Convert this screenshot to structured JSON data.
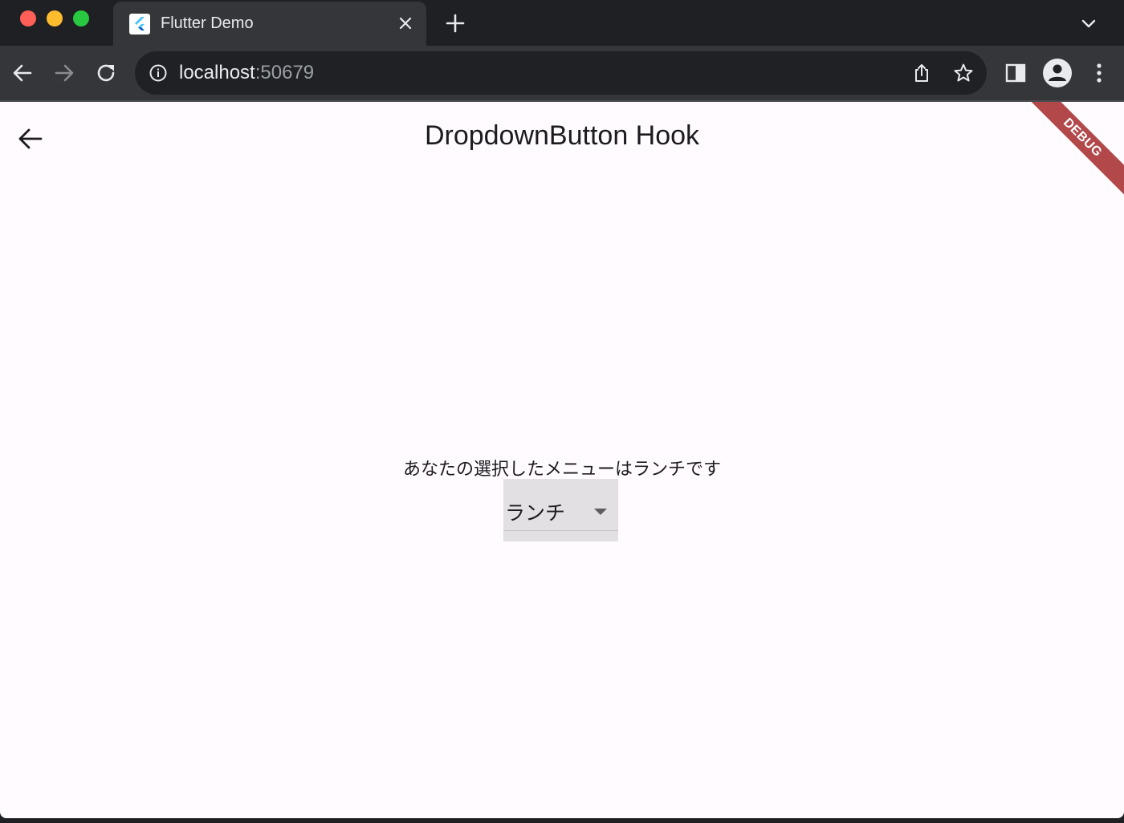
{
  "browser": {
    "tab": {
      "title": "Flutter Demo",
      "favicon": "flutter-logo-icon"
    },
    "address": {
      "host": "localhost",
      "port": ":50679"
    },
    "icons": {
      "back": "back-arrow-icon",
      "forward": "forward-arrow-icon",
      "reload": "reload-icon",
      "info": "info-icon",
      "share": "share-icon",
      "bookmark": "star-icon",
      "side_panel": "side-panel-icon",
      "profile": "profile-icon",
      "menu": "kebab-menu-icon"
    },
    "colors": {
      "chrome_dark": "#1f2023",
      "tab_active": "#35363a",
      "omnibox": "#202124"
    }
  },
  "app": {
    "appbar": {
      "title": "DropdownButton Hook",
      "back_icon": "back-arrow-icon"
    },
    "debug_banner": "DEBUG",
    "body": {
      "status_text": "あなたの選択したメニューはランチです",
      "dropdown": {
        "selected": "ランチ",
        "caret_icon": "dropdown-caret-icon"
      }
    },
    "colors": {
      "background": "#fffbfe",
      "dropdown_fill": "#e3e0e3",
      "debug_banner": "#a4282a"
    }
  }
}
